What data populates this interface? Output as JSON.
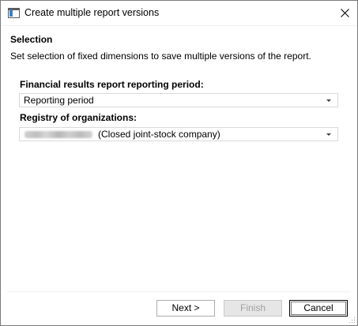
{
  "window": {
    "title": "Create multiple report versions",
    "icon": "app-window-icon",
    "close_icon": "close-icon"
  },
  "section": {
    "title": "Selection",
    "description": "Set selection of fixed dimensions to save multiple versions of the report."
  },
  "fields": [
    {
      "label": "Financial results report reporting period:",
      "value": "Reporting period"
    },
    {
      "label": "Registry of organizations:",
      "value": "(Closed joint-stock company)"
    }
  ],
  "buttons": {
    "next": "Next >",
    "finish": "Finish",
    "cancel": "Cancel"
  }
}
